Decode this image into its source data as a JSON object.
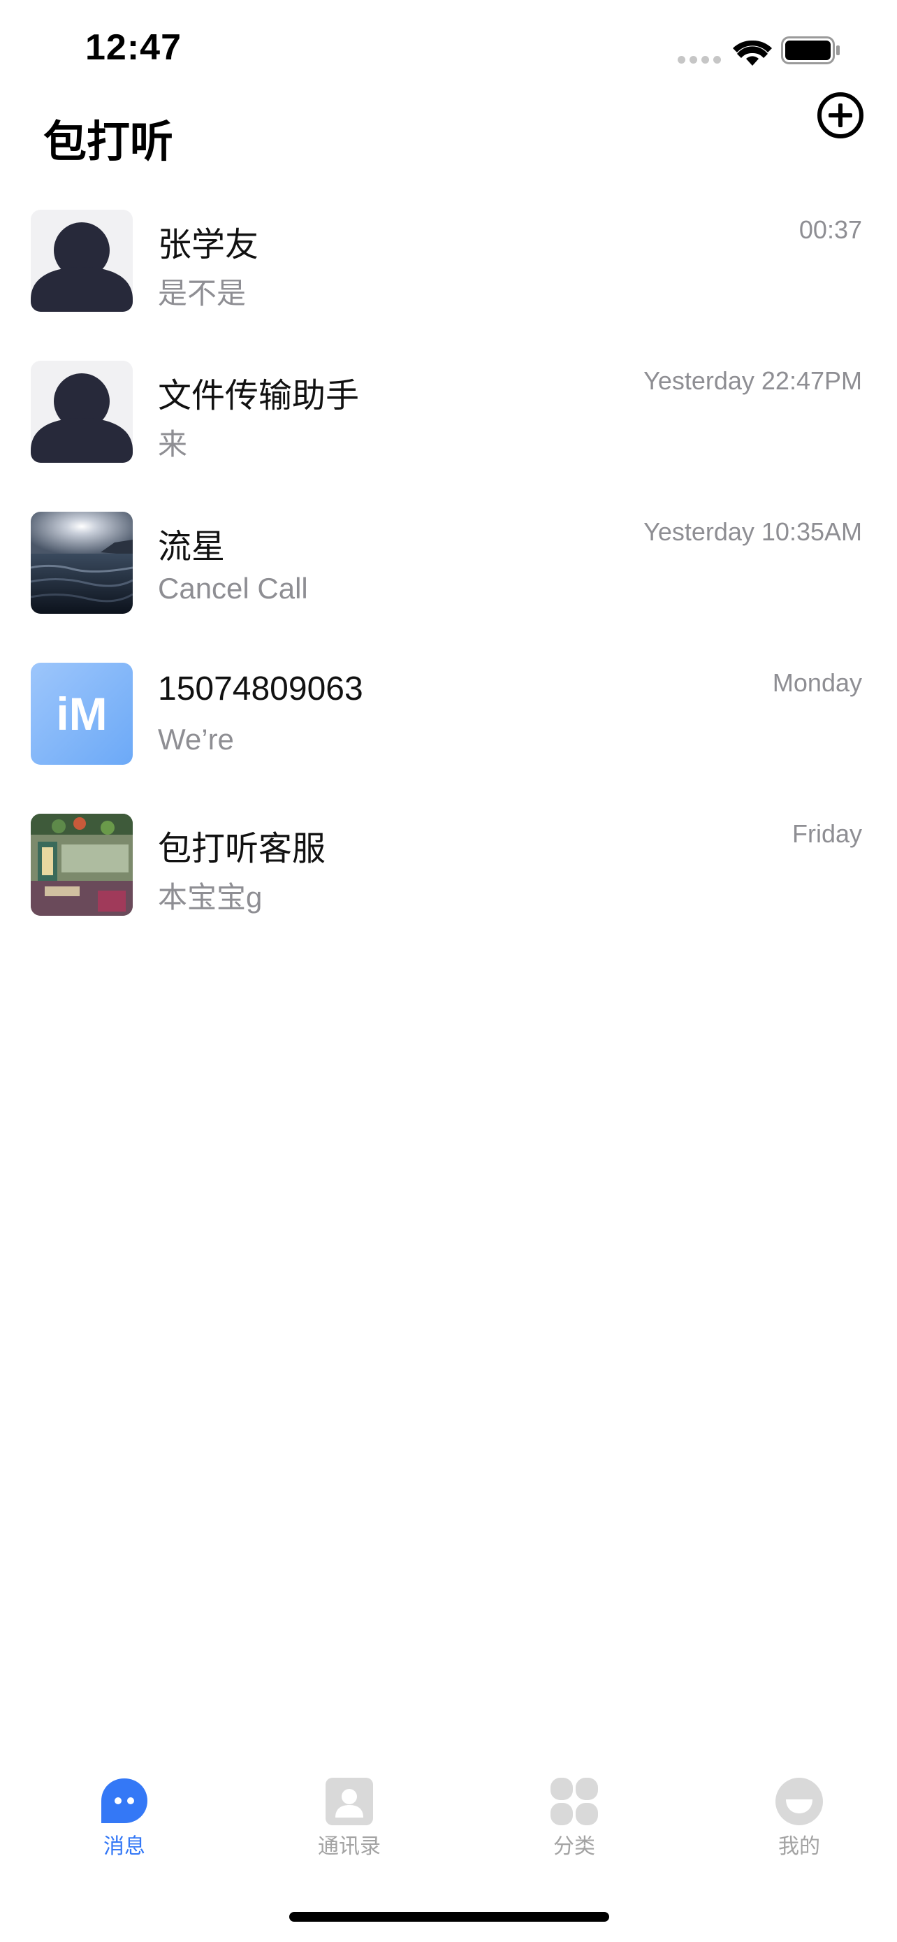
{
  "status_bar": {
    "time": "12:47"
  },
  "header": {
    "title": "包打听",
    "add_icon": "plus-circle-icon"
  },
  "chats": [
    {
      "name": "张学友",
      "preview": "是不是",
      "time": "00:37",
      "avatar": "default-person-avatar"
    },
    {
      "name": "文件传输助手",
      "preview": "来",
      "time": "Yesterday 22:47PM",
      "avatar": "default-person-avatar"
    },
    {
      "name": "流星",
      "preview": "Cancel Call",
      "time": "Yesterday 10:35AM",
      "avatar": "ocean-photo-avatar"
    },
    {
      "name": "15074809063",
      "preview": "We’re",
      "time": "Monday",
      "avatar": "im-logo-avatar",
      "avatar_text": "iM"
    },
    {
      "name": "包打听客服",
      "preview": "本宝宝g",
      "time": "Friday",
      "avatar": "shop-photo-avatar"
    }
  ],
  "tabs": [
    {
      "label": "消息",
      "icon": "chat-bubble-icon",
      "active": true
    },
    {
      "label": "通讯录",
      "icon": "contacts-icon",
      "active": false
    },
    {
      "label": "分类",
      "icon": "grid-icon",
      "active": false
    },
    {
      "label": "我的",
      "icon": "profile-icon",
      "active": false
    }
  ],
  "colors": {
    "accent": "#3478f6",
    "text_primary": "#111111",
    "text_secondary": "#8e8e93",
    "tab_inactive": "#a3a3a3",
    "avatar_dark": "#27293a"
  }
}
